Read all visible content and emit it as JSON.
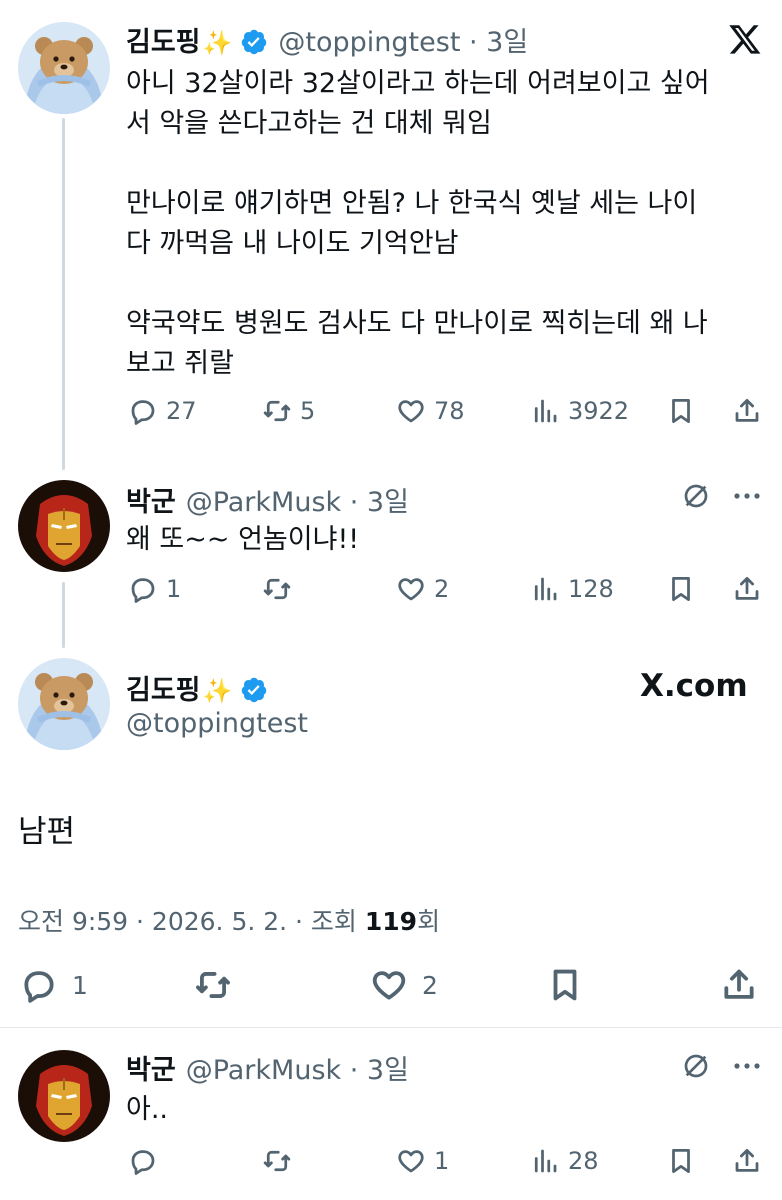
{
  "tweet1": {
    "name": "김도핑",
    "sparkle": "✨",
    "handle": "@toppingtest",
    "time": "3일",
    "text": "아니 32살이라 32살이라고 하는데 어려보이고 싶어\n서 악을 쓴다고하는 건 대체 뭐임\n\n만나이로 얘기하면 안됨? 나 한국식 옛날 세는 나이\n다 까먹음 내 나이도 기억안남\n\n약국약도 병원도 검사도 다 만나이로 찍히는데 왜 나\n보고 쥐랄",
    "replies": "27",
    "retweets": "5",
    "likes": "78",
    "views": "3922",
    "logo": "X"
  },
  "reply1": {
    "name": "박군",
    "handle": "@ParkMusk",
    "time": "3일",
    "text": "왜 또~~ 언놈이냐!!",
    "replies": "1",
    "likes": "2",
    "views": "128"
  },
  "main": {
    "name": "김도핑",
    "sparkle": "✨",
    "handle": "@toppingtest",
    "brand": "X.com",
    "text": "남편",
    "meta_prefix": "오전 9:59 · 2026. 5. 2. · 조회 ",
    "meta_count": "119",
    "meta_suffix": "회",
    "replies": "1",
    "likes": "2"
  },
  "reply2": {
    "name": "박군",
    "handle": "@ParkMusk",
    "time": "3일",
    "text": "아..",
    "likes": "1",
    "views": "28"
  },
  "colors": {
    "verified": "#1d9bf0",
    "muted": "#536471",
    "text": "#0f1419",
    "thread_line": "#cfd9de"
  }
}
